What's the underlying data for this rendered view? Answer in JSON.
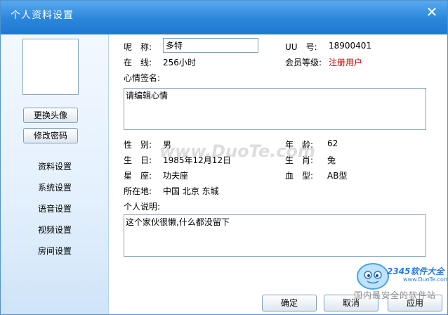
{
  "window": {
    "title": "个人资料设置"
  },
  "sidebar": {
    "change_avatar": "更换头像",
    "change_password": "修改密码",
    "nav": [
      {
        "label": "资料设置"
      },
      {
        "label": "系统设置"
      },
      {
        "label": "语音设置"
      },
      {
        "label": "视频设置"
      },
      {
        "label": "房间设置"
      }
    ]
  },
  "profile": {
    "nickname_label": "呢　称:",
    "nickname_value": "多特",
    "uu_label": "UU　号:",
    "uu_value": "18900401",
    "online_label": "在　线:",
    "online_value": "256小时",
    "level_label": "会员等级:",
    "level_value": "注册用户",
    "mood_label": "心情签名:",
    "mood_value": "请编辑心情",
    "gender_label": "性　别:",
    "gender_value": "男",
    "age_label": "年　龄:",
    "age_value": "62",
    "birthday_label": "生　日:",
    "birthday_value": "1985年12月12日",
    "zodiac_label": "生　肖:",
    "zodiac_value": "兔",
    "sign_label": "星　座:",
    "sign_value": "功夫座",
    "blood_label": "血　型:",
    "blood_value": "AB型",
    "location_label": "所在地:",
    "location_value": "中国 北京 东城",
    "bio_label": "个人说明:",
    "bio_value": "这个家伙很懒,什么都没留下"
  },
  "buttons": {
    "ok": "确定",
    "cancel": "取消",
    "apply": "应用"
  },
  "overlay": {
    "watermark": "www.DuoTe.com",
    "logo_brand": "2345软件大全",
    "logo_url": "www.DuoTe.com",
    "logo_slogan": "国内最安全的软件站"
  },
  "colors": {
    "titlebar": "#2a86db",
    "level_value": "#cc0000"
  }
}
